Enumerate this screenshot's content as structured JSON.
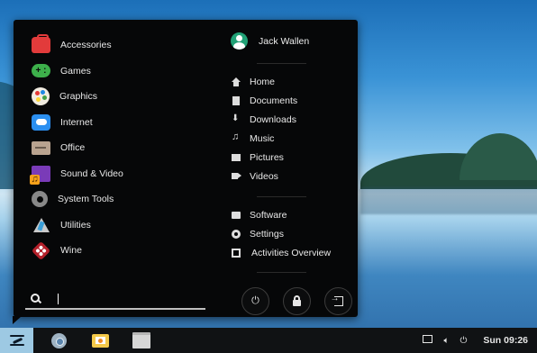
{
  "categories": [
    {
      "label": "Accessories",
      "icon": "accessories-icon"
    },
    {
      "label": "Games",
      "icon": "games-icon"
    },
    {
      "label": "Graphics",
      "icon": "graphics-icon"
    },
    {
      "label": "Internet",
      "icon": "internet-icon"
    },
    {
      "label": "Office",
      "icon": "office-icon"
    },
    {
      "label": "Sound & Video",
      "icon": "sound-video-icon"
    },
    {
      "label": "System Tools",
      "icon": "system-tools-icon"
    },
    {
      "label": "Utilities",
      "icon": "utilities-icon"
    },
    {
      "label": "Wine",
      "icon": "wine-icon"
    }
  ],
  "search": {
    "value": ""
  },
  "user": {
    "name": "Jack Wallen"
  },
  "places": [
    {
      "label": "Home",
      "icon": "home-icon"
    },
    {
      "label": "Documents",
      "icon": "document-icon"
    },
    {
      "label": "Downloads",
      "icon": "download-icon"
    },
    {
      "label": "Music",
      "icon": "music-icon"
    },
    {
      "label": "Pictures",
      "icon": "picture-icon"
    },
    {
      "label": "Videos",
      "icon": "video-icon"
    }
  ],
  "system": [
    {
      "label": "Software",
      "icon": "software-icon"
    },
    {
      "label": "Settings",
      "icon": "settings-icon"
    },
    {
      "label": "Activities Overview",
      "icon": "activities-icon"
    }
  ],
  "session_buttons": [
    "power-icon",
    "lock-icon",
    "logout-icon"
  ],
  "taskbar": {
    "apps": [
      "chrome-icon",
      "mail-icon",
      "files-icon"
    ],
    "clock": "Sun 09:26"
  },
  "colors": {
    "menu_bg": "#060708",
    "accent_user": "#21a176",
    "start_button": "#9dc9e3"
  }
}
